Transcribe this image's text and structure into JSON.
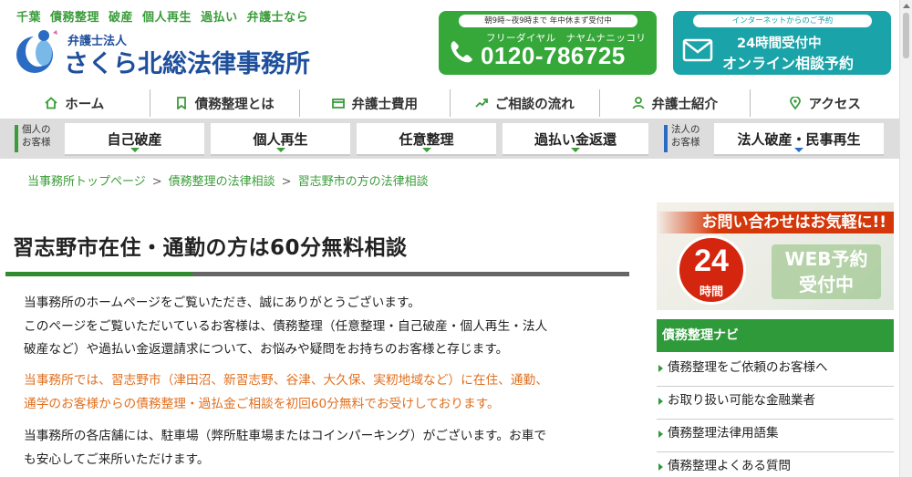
{
  "header": {
    "tagline": [
      "千葉",
      "債務整理",
      "破産",
      "個人再生",
      "過払い",
      "弁護士なら"
    ],
    "logo_sub": "弁護士法人",
    "logo_main": "さくら北総法律事務所",
    "phone": {
      "hours": "朝9時~夜9時まで 年中休まず受付中",
      "free_dial": "フリーダイヤル　ナヤムナニッコリ",
      "number": "0120-786725"
    },
    "online": {
      "top": "インターネットからのご予約",
      "line1": "24時間受付中",
      "line2": "オンライン相談予約"
    }
  },
  "main_nav": [
    {
      "label": "ホーム",
      "icon": "home-icon"
    },
    {
      "label": "債務整理とは",
      "icon": "bookmark-icon"
    },
    {
      "label": "弁護士費用",
      "icon": "card-icon"
    },
    {
      "label": "ご相談の流れ",
      "icon": "trend-icon"
    },
    {
      "label": "弁護士紹介",
      "icon": "person-icon"
    },
    {
      "label": "アクセス",
      "icon": "pin-icon"
    }
  ],
  "sub_nav": {
    "personal_label_1": "個人の",
    "personal_label_2": "お客様",
    "corporate_label_1": "法人の",
    "corporate_label_2": "お客様",
    "items": [
      "自己破産",
      "個人再生",
      "任意整理",
      "過払い金返還"
    ],
    "corporate_item": "法人破産・民事再生"
  },
  "breadcrumb": [
    "当事務所トップページ",
    "債務整理の法律相談",
    "習志野市の方の法律相談"
  ],
  "page_title": "習志野市在住・通勤の方は60分無料相談",
  "content": {
    "p1_l1": "当事務所のホームページをご覧いただき、誠にありがとうございます。",
    "p1_l2": "このページをご覧いただいているお客様は、債務整理（任意整理・自己破産・個人再生・法人",
    "p1_l3": "破産など）や過払い金返還請求について、お悩みや疑問をお持ちのお客様と存じます。",
    "p2_l1": "当事務所では、習志野市（津田沼、新習志野、谷津、大久保、実籾地域など）に在住、通勤、",
    "p2_l2": "通学のお客様からの債務整理・過払金ご相談を初回60分無料でお受けしております。",
    "p3_l1": "当事務所の各店舗には、駐車場（弊所駐車場またはコインパーキング）がございます。お車で",
    "p3_l2": "も安心してご来所いただけます。"
  },
  "sidebar": {
    "banner_head": "お問い合わせはお気軽に!!",
    "banner_24": "24",
    "banner_jikan": "時間",
    "banner_web_1": "WEB予約",
    "banner_web_2": "受付中",
    "nav_title": "債務整理ナビ",
    "nav_items": [
      "債務整理をご依頼のお客様へ",
      "お取り扱い可能な金融業者",
      "債務整理法律用語集",
      "債務整理よくある質問"
    ]
  },
  "colors": {
    "green": "#3a9c3a",
    "blue": "#1e4f9c",
    "teal": "#1aa3a8",
    "orange": "#e07020",
    "red": "#d4260f"
  }
}
